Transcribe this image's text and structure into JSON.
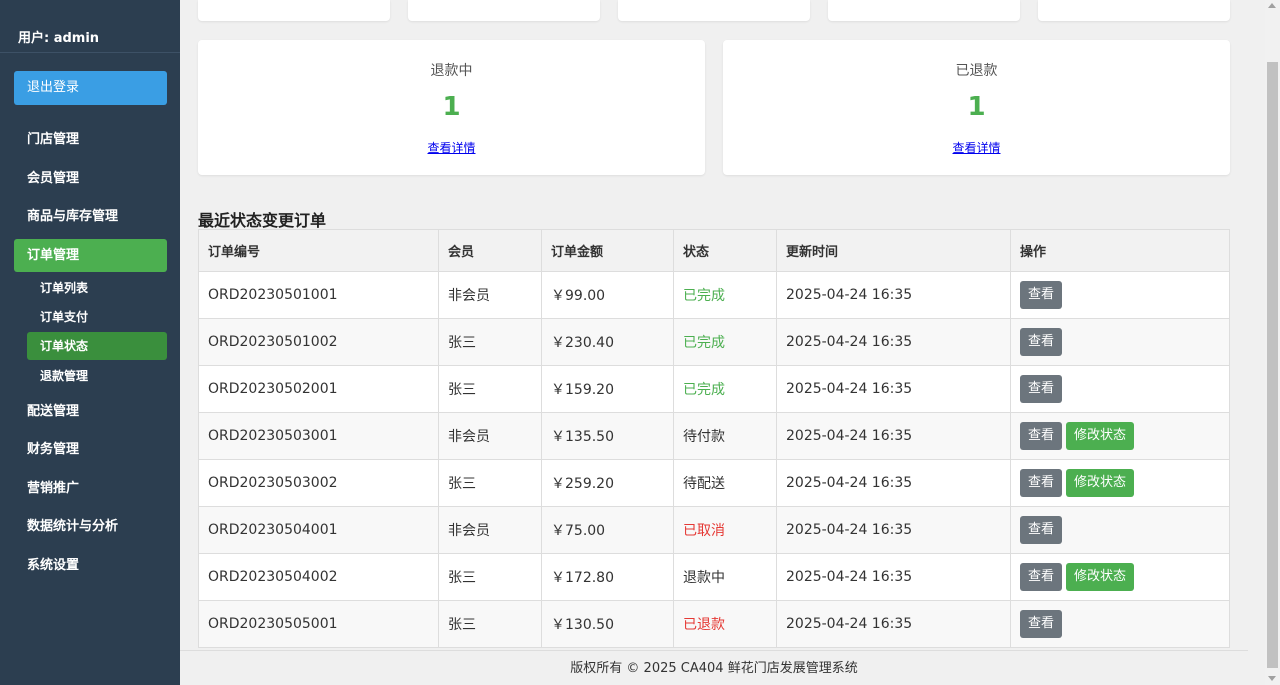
{
  "sidebar": {
    "user": "用户: admin",
    "logout": "退出登录",
    "items": [
      {
        "label": "门店管理"
      },
      {
        "label": "会员管理"
      },
      {
        "label": "商品与库存管理"
      },
      {
        "label": "订单管理"
      },
      {
        "label": "配送管理"
      },
      {
        "label": "财务管理"
      },
      {
        "label": "营销推广"
      },
      {
        "label": "数据统计与分析"
      },
      {
        "label": "系统设置"
      }
    ],
    "subitems": [
      {
        "label": "订单列表"
      },
      {
        "label": "订单支付"
      },
      {
        "label": "订单状态"
      },
      {
        "label": "退款管理"
      }
    ],
    "active_item": "订单管理",
    "active_sub": "订单状态"
  },
  "cards": [
    {
      "label": "退款中",
      "count": "1",
      "link": "查看详情"
    },
    {
      "label": "已退款",
      "count": "1",
      "link": "查看详情"
    }
  ],
  "section_title": "最近状态变更订单",
  "table": {
    "headers": [
      "订单编号",
      "会员",
      "订单金额",
      "状态",
      "更新时间",
      "操作"
    ],
    "view_label": "查看",
    "modify_label": "修改状态",
    "rows": [
      {
        "id": "ORD20230501001",
        "member": "非会员",
        "amount": "￥99.00",
        "status": "已完成",
        "time": "2025-04-24 16:35"
      },
      {
        "id": "ORD20230501002",
        "member": "张三",
        "amount": "￥230.40",
        "status": "已完成",
        "time": "2025-04-24 16:35"
      },
      {
        "id": "ORD20230502001",
        "member": "张三",
        "amount": "￥159.20",
        "status": "已完成",
        "time": "2025-04-24 16:35"
      },
      {
        "id": "ORD20230503001",
        "member": "非会员",
        "amount": "￥135.50",
        "status": "待付款",
        "time": "2025-04-24 16:35"
      },
      {
        "id": "ORD20230503002",
        "member": "张三",
        "amount": "￥259.20",
        "status": "待配送",
        "time": "2025-04-24 16:35"
      },
      {
        "id": "ORD20230504001",
        "member": "非会员",
        "amount": "￥75.00",
        "status": "已取消",
        "time": "2025-04-24 16:35"
      },
      {
        "id": "ORD20230504002",
        "member": "张三",
        "amount": "￥172.80",
        "status": "退款中",
        "time": "2025-04-24 16:35"
      },
      {
        "id": "ORD20230505001",
        "member": "张三",
        "amount": "￥130.50",
        "status": "已退款",
        "time": "2025-04-24 16:35"
      }
    ]
  },
  "footer": "版权所有 © 2025 CA404 鲜花门店发展管理系统",
  "colors": {
    "sidebar_bg": "#2c3e50",
    "logout_bg": "#3a9ee4",
    "active_green": "#4caf50",
    "status_done": "#4caf50",
    "status_cancel": "#e53935",
    "view_button": "#6c757d"
  }
}
